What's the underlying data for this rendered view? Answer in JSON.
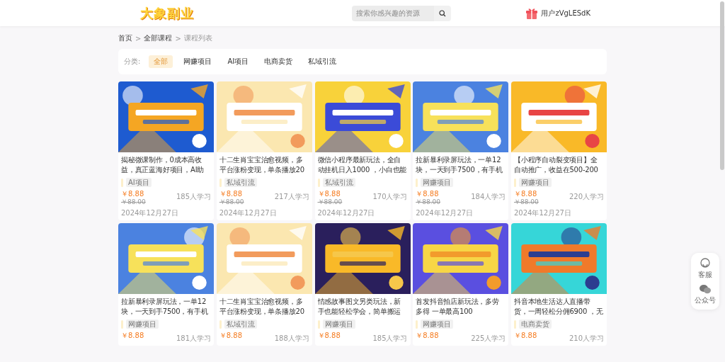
{
  "header": {
    "logo": "大象副业",
    "search": {
      "placeholder": "搜索你感兴趣的资源"
    },
    "user": "用户zVgLESdK"
  },
  "breadcrumb": [
    {
      "label": "首页",
      "current": false
    },
    {
      "prefix": ">",
      "label": "全部课程",
      "current": false
    },
    {
      "prefix": ">",
      "label": "课程列表",
      "current": true
    }
  ],
  "filter": {
    "label": "分类:",
    "options": [
      {
        "label": "全部",
        "selected": true
      },
      {
        "label": "网赚项目",
        "selected": false
      },
      {
        "label": "AI项目",
        "selected": false
      },
      {
        "label": "电商卖货",
        "selected": false
      },
      {
        "label": "私域引流",
        "selected": false
      }
    ]
  },
  "courses": [
    {
      "title": [
        "揭秘微课制作，0成本高收",
        "益，真正蓝海好项目，AI助"
      ],
      "tag": "AI项目",
      "price": "￥8.88",
      "original_price": "￥88.00",
      "learners": "185人学习",
      "date": "2024年12月27日"
    },
    {
      "title": [
        "十二生肖宝宝治愈视频，多",
        "平台涨粉变现，单条播放20"
      ],
      "tag": "私域引流",
      "price": "￥8.88",
      "original_price": "￥88.00",
      "learners": "217人学习",
      "date": "2024年12月27日"
    },
    {
      "title": [
        "微信小程序最新玩法，全自",
        "动挂机日入1000 ，小白也能"
      ],
      "tag": "私域引流",
      "price": "￥8.88",
      "original_price": "￥88.00",
      "learners": "170人学习",
      "date": "2024年12月27日"
    },
    {
      "title": [
        "拉新暴利录屏玩法，一单12",
        "块，一天到手7500，有手机"
      ],
      "tag": "网赚项目",
      "price": "￥8.88",
      "original_price": "￥88.00",
      "learners": "184人学习",
      "date": "2024年12月27日"
    },
    {
      "title": [
        "【小程序自动裂变项目】全",
        "自动推广，收益在500-200"
      ],
      "tag": "网赚项目",
      "price": "￥8.88",
      "original_price": "￥88.00",
      "learners": "220人学习",
      "date": "2024年12月27日"
    },
    {
      "title": [
        "拉新暴利录屏玩法，一单12",
        "块，一天到手7500，有手机"
      ],
      "tag": "网赚项目",
      "price": "￥8.88",
      "learners": "181人学习"
    },
    {
      "title": [
        "十二生肖宝宝治愈视频，多",
        "平台涨粉变现，单条播放20"
      ],
      "tag": "私域引流",
      "price": "￥8.88",
      "learners": "188人学习"
    },
    {
      "title": [
        "情感故事图文另类玩法，新",
        "手也能轻松学会，简单搬运"
      ],
      "tag": "网赚项目",
      "price": "￥8.88",
      "learners": "185人学习"
    },
    {
      "title": [
        "首发抖音拍店新玩法，多劳",
        "多得 一单最高100"
      ],
      "tag": "网赚项目",
      "price": "￥8.88",
      "learners": "225人学习"
    },
    {
      "title": [
        "抖音本地生活达人直播带",
        "货，一周轻松分佣6900 ，无"
      ],
      "tag": "电商卖货",
      "price": "￥8.88",
      "learners": "210人学习"
    }
  ],
  "float_panel": [
    {
      "kind": "service",
      "label": "客服"
    },
    {
      "kind": "wechat",
      "label": "公众号"
    }
  ]
}
